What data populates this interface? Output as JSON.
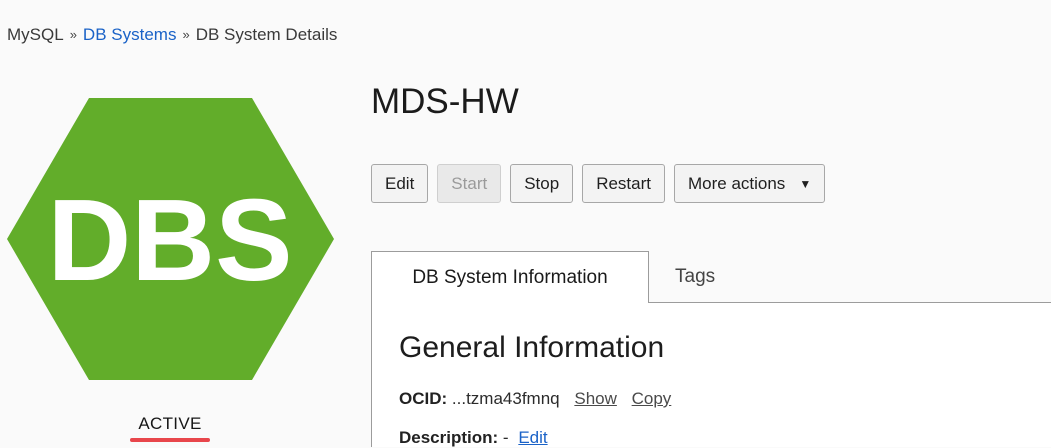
{
  "breadcrumb": {
    "items": [
      "MySQL",
      "DB Systems",
      "DB System Details"
    ],
    "separator": "»"
  },
  "logo": {
    "text": "DBS",
    "icon": "hexagon-dbs-icon",
    "color": "#62ad2a"
  },
  "status": {
    "text": "ACTIVE",
    "underline_color": "#e8464b"
  },
  "title": "MDS-HW",
  "toolbar": {
    "edit": "Edit",
    "start": "Start",
    "stop": "Stop",
    "restart": "Restart",
    "more_actions": "More actions",
    "more_caret": "▼"
  },
  "tabs": [
    {
      "label": "DB System Information",
      "active": true
    },
    {
      "label": "Tags",
      "active": false
    }
  ],
  "general": {
    "title": "General Information",
    "ocid_label": "OCID:",
    "ocid_value": "...tzma43fmnq",
    "show": "Show",
    "copy": "Copy",
    "description_label": "Description:",
    "description_value": "-",
    "edit": "Edit"
  }
}
